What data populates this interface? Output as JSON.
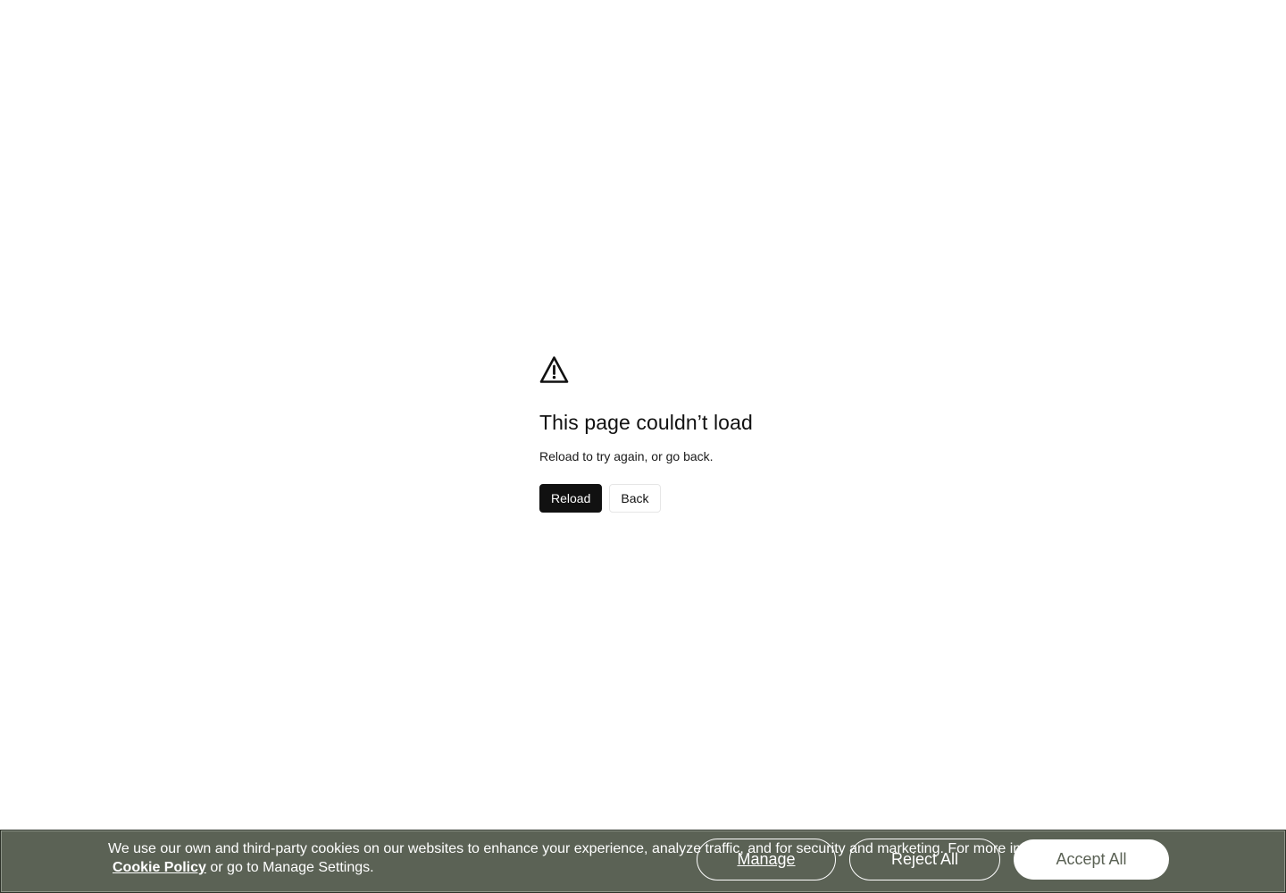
{
  "error": {
    "icon": "warning-triangle-icon",
    "title": "This page couldn’t load",
    "subtitle": "Reload to try again, or go back.",
    "reload_label": "Reload",
    "back_label": "Back"
  },
  "cookie_banner": {
    "text_line1": "We use our own and third-party cookies on our websites to enhance your experience, analyze traffic, and for security and marketing. For more info, see our",
    "policy_link": "Cookie Policy",
    "text_line2_suffix": " or go to Manage Settings.",
    "manage_label": "Manage",
    "reject_label": "Reject All",
    "accept_label": "Accept All",
    "colors": {
      "background": "#5b6255",
      "text": "#ffffff"
    }
  }
}
